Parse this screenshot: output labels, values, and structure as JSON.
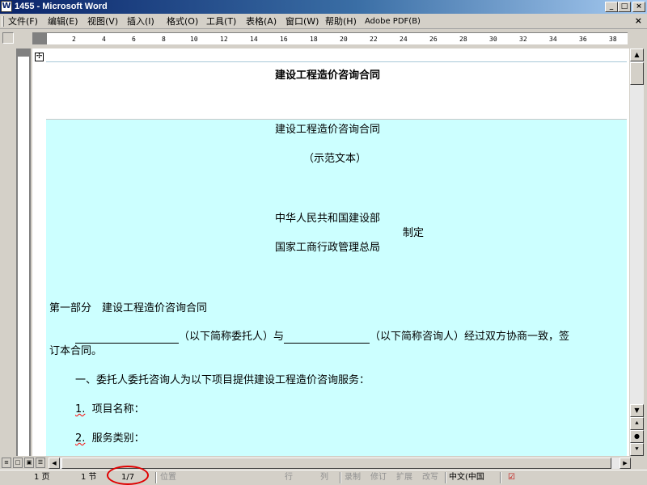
{
  "window": {
    "title": "1455 - Microsoft Word",
    "app_icon": "W",
    "buttons": [
      "_",
      "□",
      "×"
    ]
  },
  "menu": {
    "items": [
      "文件(F)",
      "编辑(E)",
      "视图(V)",
      "插入(I)",
      "格式(O)",
      "工具(T)",
      "表格(A)",
      "窗口(W)",
      "帮助(H)",
      "Adobe PDF(B)"
    ],
    "close_doc": "×"
  },
  "ruler": {
    "ticks": [
      "2",
      "4",
      "6",
      "8",
      "10",
      "12",
      "14",
      "16",
      "18",
      "20",
      "22",
      "24",
      "26",
      "28",
      "30",
      "32",
      "34",
      "36",
      "38"
    ]
  },
  "document": {
    "header_title": "建设工程造价咨询合同",
    "title": "建设工程造价咨询合同",
    "subtitle": "（示范文本）",
    "issuer_1": "中华人民共和国建设部",
    "issuer_2": "国家工商行政管理总局",
    "issuer_suffix": "制定",
    "part_heading": "第一部分　建设工程造价咨询合同",
    "para1_a": "（以下简称委托人）与",
    "para1_b": "（以下简称咨询人）经过双方协商一致，签",
    "para1_c": "订本合同。",
    "item_heading": "一、委托人委托咨询人为以下项目提供建设工程造价咨询服务：",
    "item1_num": "1.",
    "item1_label": "项目名称：",
    "item2_num": "2.",
    "item2_label": "服务类别："
  },
  "status": {
    "page": "1 页",
    "section": "1 节",
    "pages": "1/7",
    "position": "位置",
    "line": "行",
    "col": "列",
    "rec": "录制",
    "trk": "修订",
    "ext": "扩展",
    "ovr": "改写",
    "lang": "中文(中国",
    "spell_icon": "book-check-icon"
  },
  "colors": {
    "title_gradient_start": "#0a246a",
    "body_highlight": "#ccffff",
    "annotation_ring": "#e00000"
  }
}
